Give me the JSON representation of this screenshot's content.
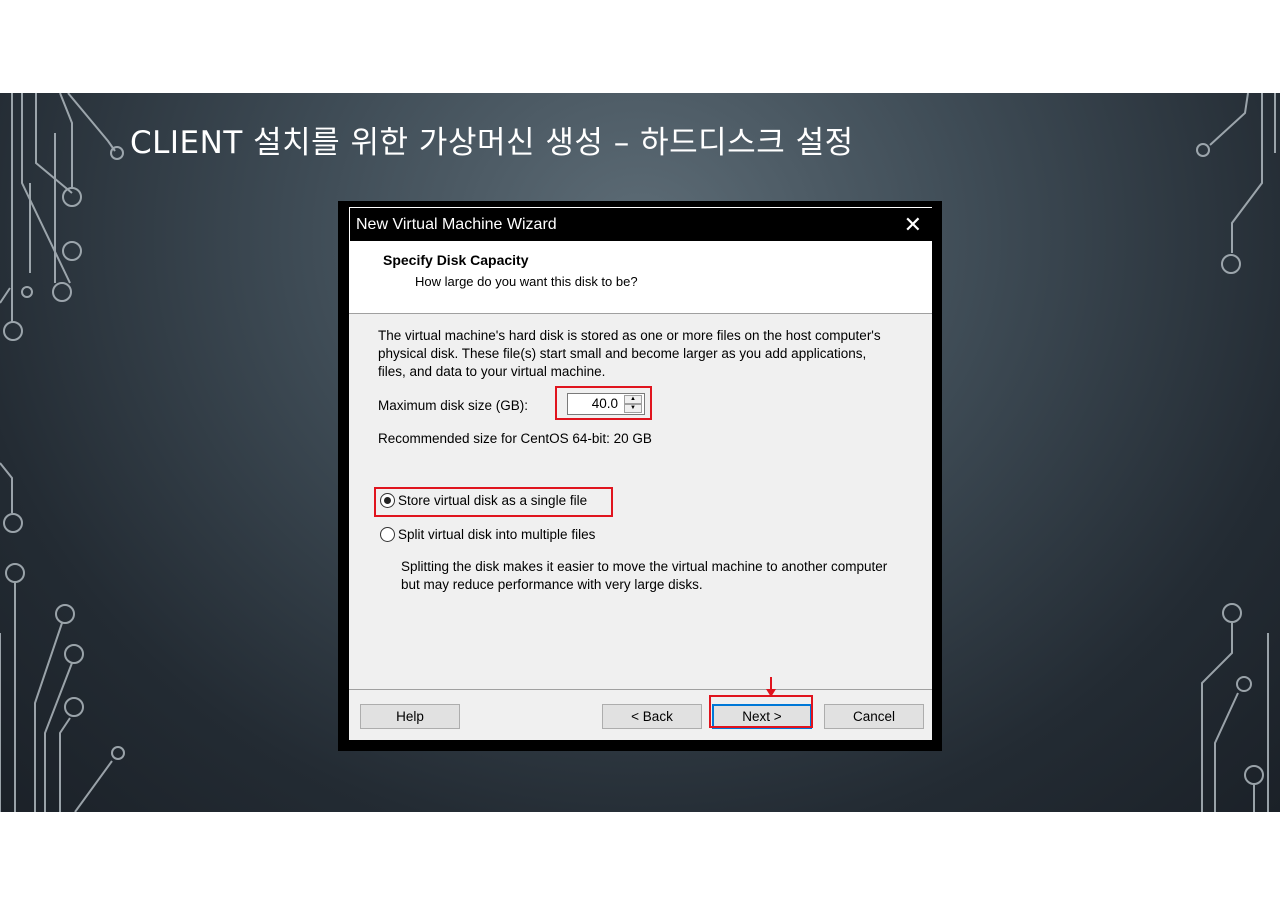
{
  "slide": {
    "title": "CLIENT 설치를 위한 가상머신 생성 – 하드디스크 설정"
  },
  "dialog": {
    "title": "New Virtual Machine Wizard",
    "close_symbol": "✕",
    "header_title": "Specify Disk Capacity",
    "header_subtitle": "How large do you want this disk to be?",
    "description": "The virtual machine's hard disk is stored as one or more files on the host computer's physical disk. These file(s) start small and become larger as you add applications, files, and data to your virtual machine.",
    "max_size_label": "Maximum disk size (GB):",
    "max_size_value": "40.0",
    "recommended": "Recommended size for CentOS 64-bit: 20 GB",
    "option_single": "Store virtual disk as a single file",
    "option_split": "Split virtual disk into multiple files",
    "split_description": "Splitting the disk makes it easier to move the virtual machine to another computer but may reduce performance with very large disks.",
    "selected_option": "single",
    "buttons": {
      "help": "Help",
      "back": "< Back",
      "next": "Next >",
      "cancel": "Cancel"
    }
  },
  "colors": {
    "highlight": "#e0141e",
    "focus": "#0078d7"
  }
}
